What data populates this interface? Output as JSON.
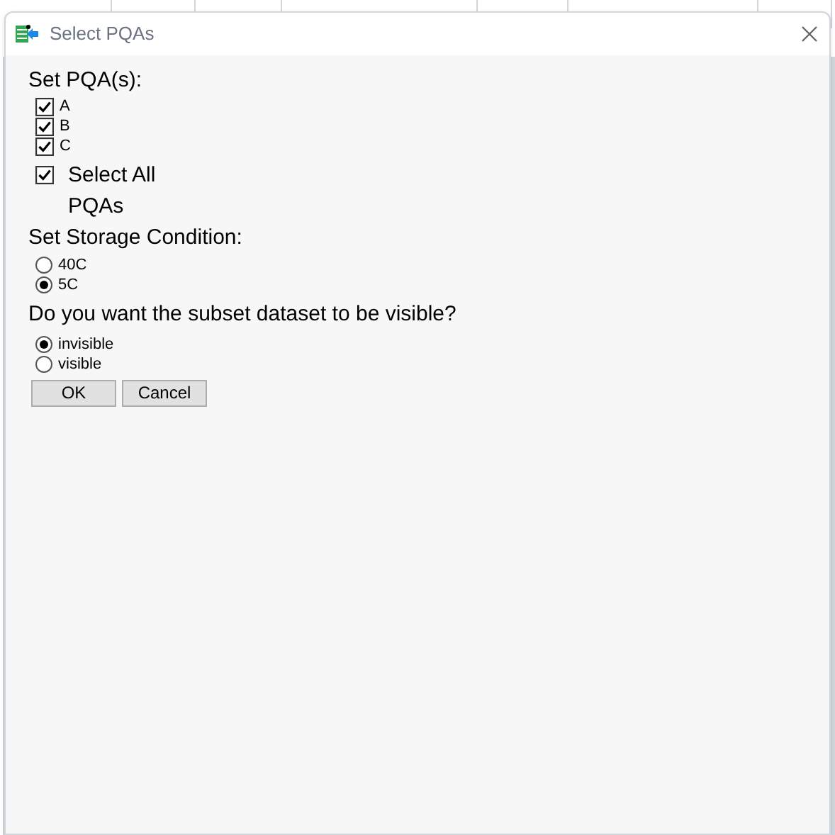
{
  "window": {
    "title": "Select PQAs"
  },
  "pqa_section": {
    "label": "Set PQA(s):",
    "options": [
      {
        "label": "A",
        "checked": true
      },
      {
        "label": "B",
        "checked": true
      },
      {
        "label": "C",
        "checked": true
      }
    ],
    "select_all": {
      "label": "Select All",
      "label_line2": "PQAs",
      "checked": true
    }
  },
  "storage_section": {
    "label": "Set Storage Condition:",
    "options": [
      {
        "label": "40C",
        "selected": false
      },
      {
        "label": "5C",
        "selected": true
      }
    ]
  },
  "visibility_section": {
    "label": "Do you want the subset dataset to be visible?",
    "options": [
      {
        "label": "invisible",
        "selected": true
      },
      {
        "label": "visible",
        "selected": false
      }
    ]
  },
  "buttons": [
    "OK",
    "Cancel"
  ]
}
